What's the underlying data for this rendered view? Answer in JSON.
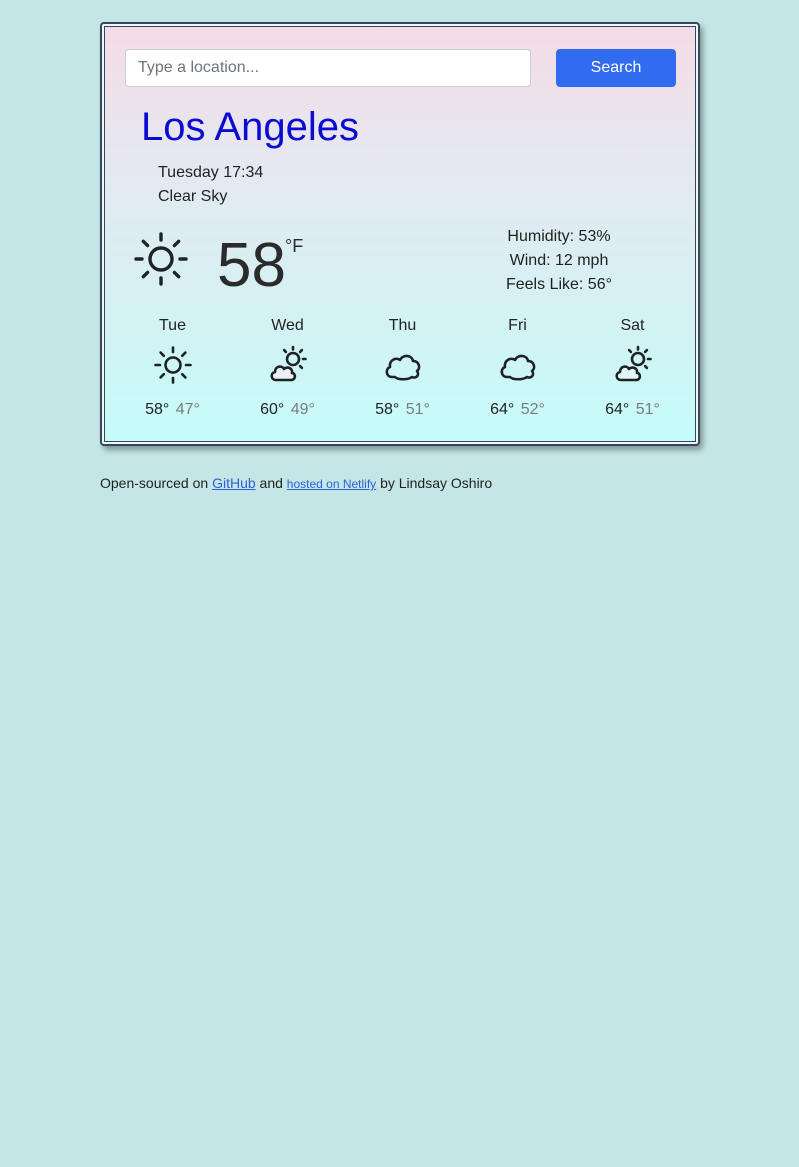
{
  "search": {
    "placeholder": "Type a location...",
    "value": "",
    "button_label": "Search"
  },
  "current": {
    "city": "Los Angeles",
    "datetime": "Tuesday 17:34",
    "description": "Clear Sky",
    "icon": "sun-icon",
    "temperature": "58",
    "unit": "°F",
    "humidity": "Humidity: 53%",
    "wind": "Wind: 12 mph",
    "feels_like": "Feels Like: 56°"
  },
  "forecast": [
    {
      "day": "Tue",
      "icon": "sun-icon",
      "high": "58°",
      "low": "47°"
    },
    {
      "day": "Wed",
      "icon": "partly-cloudy-icon",
      "high": "60°",
      "low": "49°"
    },
    {
      "day": "Thu",
      "icon": "cloud-icon",
      "high": "58°",
      "low": "51°"
    },
    {
      "day": "Fri",
      "icon": "cloud-icon",
      "high": "64°",
      "low": "52°"
    },
    {
      "day": "Sat",
      "icon": "partly-cloudy-icon",
      "high": "64°",
      "low": "51°"
    }
  ],
  "footer": {
    "prefix": "Open-sourced on",
    "github_link": "GitHub",
    "middle": "and",
    "netlify_link": "hosted on Netlify",
    "suffix": "by Lindsay Oshiro"
  },
  "colors": {
    "page_background": "#c4e6e6",
    "city_text": "#0b0bd2",
    "search_button": "#316bef",
    "card_border": "#34495e",
    "low_temp_text": "#7b7b7b"
  }
}
